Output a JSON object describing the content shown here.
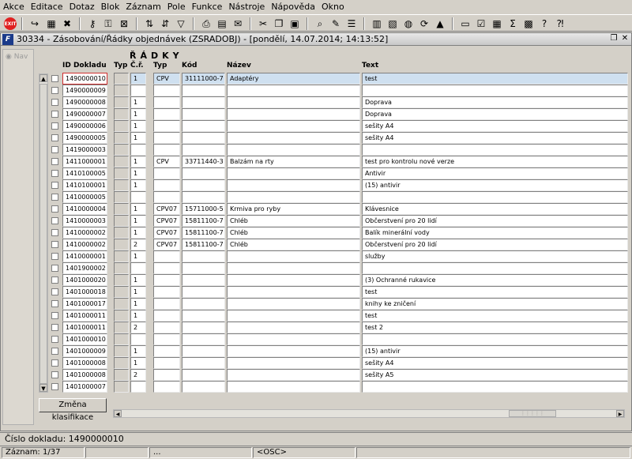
{
  "menu": [
    "Akce",
    "Editace",
    "Dotaz",
    "Blok",
    "Záznam",
    "Pole",
    "Funkce",
    "Nástroje",
    "Nápověda",
    "Okno"
  ],
  "toolbar": {
    "exit_label": "EXIT"
  },
  "window": {
    "title": "30334 - Zásobování/Řádky objednávek (ZSRADOBJ) - [pondělí, 14.07.2014; 14:13:52]"
  },
  "nav": {
    "label": "Nav"
  },
  "block": {
    "title": "ŘÁDKY"
  },
  "headers": {
    "id": "ID Dokladu",
    "typ1": "Typ",
    "cr": "Č.ř.",
    "typ2": "Typ",
    "kod": "Kód",
    "nazev": "Název",
    "text": "Text"
  },
  "rows": [
    {
      "id": "1490000010",
      "cr": "1",
      "typ": "CPV",
      "kod": "31111000-7",
      "nazev": "Adaptéry",
      "text": "test"
    },
    {
      "id": "1490000009",
      "cr": "",
      "typ": "",
      "kod": "",
      "nazev": "",
      "text": ""
    },
    {
      "id": "1490000008",
      "cr": "1",
      "typ": "",
      "kod": "",
      "nazev": "",
      "text": "Doprava"
    },
    {
      "id": "1490000007",
      "cr": "1",
      "typ": "",
      "kod": "",
      "nazev": "",
      "text": "Doprava"
    },
    {
      "id": "1490000006",
      "cr": "1",
      "typ": "",
      "kod": "",
      "nazev": "",
      "text": "sešity A4"
    },
    {
      "id": "1490000005",
      "cr": "1",
      "typ": "",
      "kod": "",
      "nazev": "",
      "text": "sešity A4"
    },
    {
      "id": "1419000003",
      "cr": "",
      "typ": "",
      "kod": "",
      "nazev": "",
      "text": ""
    },
    {
      "id": "1411000001",
      "cr": "1",
      "typ": "CPV",
      "kod": "33711440-3",
      "nazev": "Balzám na rty",
      "text": "test pro kontrolu nové verze"
    },
    {
      "id": "1410100005",
      "cr": "1",
      "typ": "",
      "kod": "",
      "nazev": "",
      "text": "Antivir"
    },
    {
      "id": "1410100001",
      "cr": "1",
      "typ": "",
      "kod": "",
      "nazev": "",
      "text": "(15) antivir"
    },
    {
      "id": "1410000005",
      "cr": "",
      "typ": "",
      "kod": "",
      "nazev": "",
      "text": ""
    },
    {
      "id": "1410000004",
      "cr": "1",
      "typ": "CPV07",
      "kod": "15711000-5",
      "nazev": "Krmiva pro ryby",
      "text": "Klávesnice"
    },
    {
      "id": "1410000003",
      "cr": "1",
      "typ": "CPV07",
      "kod": "15811100-7",
      "nazev": "Chléb",
      "text": "Občerstvení pro 20 lidí"
    },
    {
      "id": "1410000002",
      "cr": "1",
      "typ": "CPV07",
      "kod": "15811100-7",
      "nazev": "Chléb",
      "text": "Balík minerální vody"
    },
    {
      "id": "1410000002",
      "cr": "2",
      "typ": "CPV07",
      "kod": "15811100-7",
      "nazev": "Chléb",
      "text": "Občerstvení pro 20 lidí"
    },
    {
      "id": "1410000001",
      "cr": "1",
      "typ": "",
      "kod": "",
      "nazev": "",
      "text": "služby"
    },
    {
      "id": "1401900002",
      "cr": "",
      "typ": "",
      "kod": "",
      "nazev": "",
      "text": ""
    },
    {
      "id": "1401000020",
      "cr": "1",
      "typ": "",
      "kod": "",
      "nazev": "",
      "text": "(3) Ochranné rukavice"
    },
    {
      "id": "1401000018",
      "cr": "1",
      "typ": "",
      "kod": "",
      "nazev": "",
      "text": "test"
    },
    {
      "id": "1401000017",
      "cr": "1",
      "typ": "",
      "kod": "",
      "nazev": "",
      "text": "knihy ke zničení"
    },
    {
      "id": "1401000011",
      "cr": "1",
      "typ": "",
      "kod": "",
      "nazev": "",
      "text": "test"
    },
    {
      "id": "1401000011",
      "cr": "2",
      "typ": "",
      "kod": "",
      "nazev": "",
      "text": "test 2"
    },
    {
      "id": "1401000010",
      "cr": "",
      "typ": "",
      "kod": "",
      "nazev": "",
      "text": ""
    },
    {
      "id": "1401000009",
      "cr": "1",
      "typ": "",
      "kod": "",
      "nazev": "",
      "text": "(15) antivir"
    },
    {
      "id": "1401000008",
      "cr": "1",
      "typ": "",
      "kod": "",
      "nazev": "",
      "text": "sešity A4"
    },
    {
      "id": "1401000008",
      "cr": "2",
      "typ": "",
      "kod": "",
      "nazev": "",
      "text": "sešity A5"
    },
    {
      "id": "1401000007",
      "cr": "",
      "typ": "",
      "kod": "",
      "nazev": "",
      "text": ""
    }
  ],
  "buttons": {
    "klasifikace": "Změna klasifikace"
  },
  "status": {
    "line1": "Číslo dokladu: 1490000010",
    "record": "Záznam: 1/37",
    "dots": "...",
    "osc": "<OSC>"
  }
}
